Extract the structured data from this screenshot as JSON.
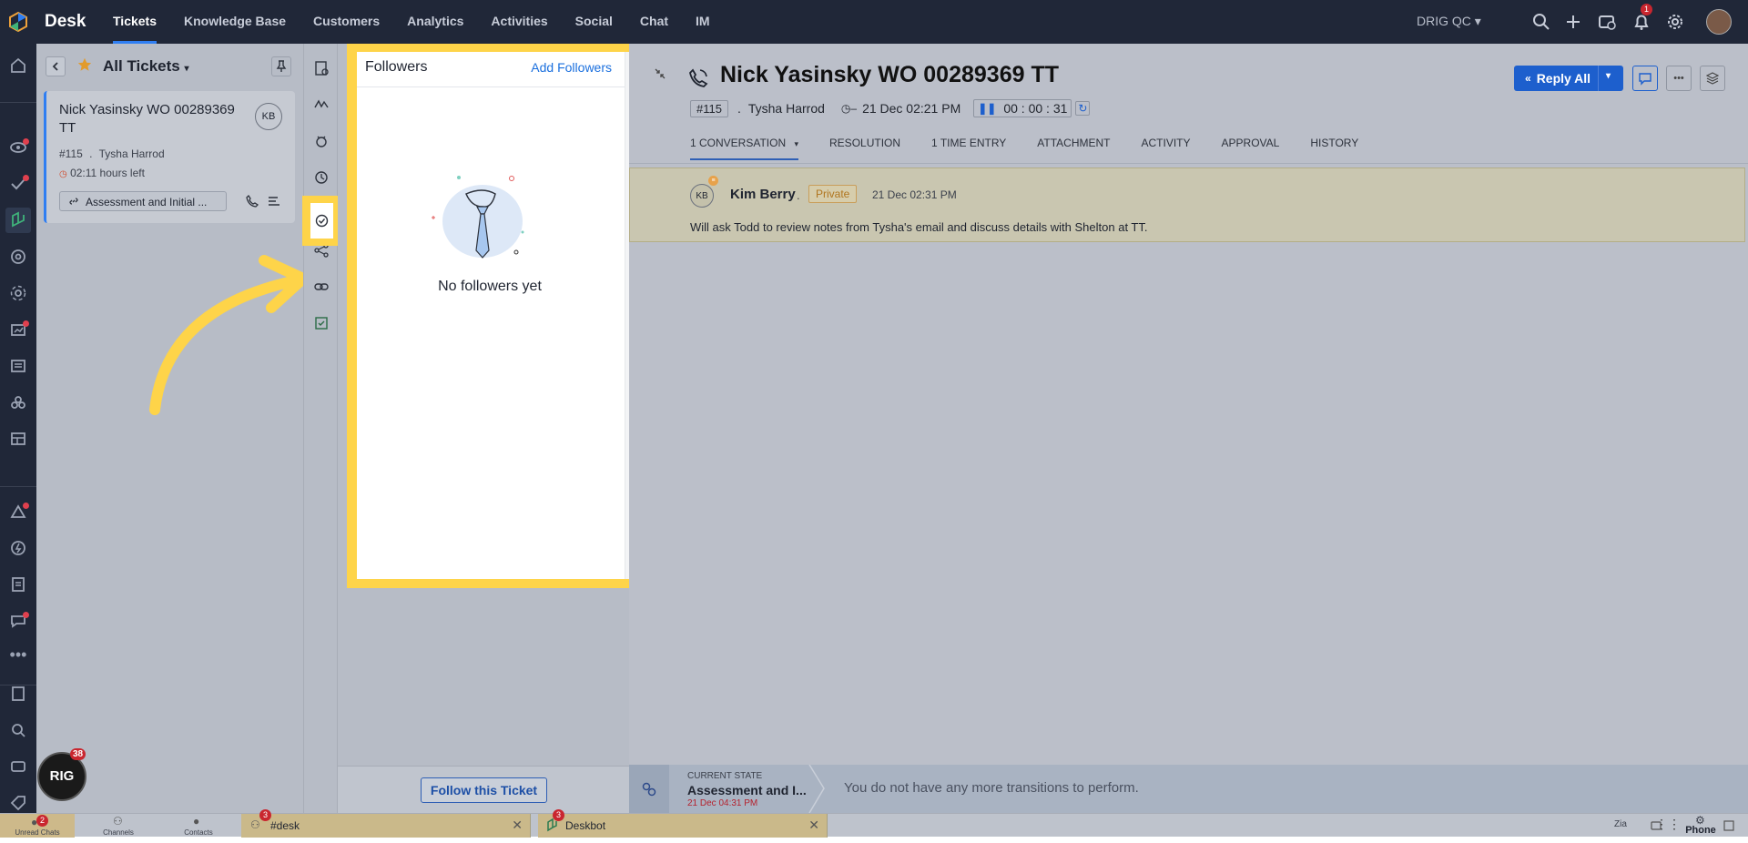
{
  "app": {
    "name": "Desk",
    "org": "DRIG QC",
    "notification_count": "1"
  },
  "nav": [
    {
      "label": "Tickets",
      "active": true
    },
    {
      "label": "Knowledge Base"
    },
    {
      "label": "Customers"
    },
    {
      "label": "Analytics"
    },
    {
      "label": "Activities"
    },
    {
      "label": "Social"
    },
    {
      "label": "Chat"
    },
    {
      "label": "IM"
    }
  ],
  "list": {
    "title": "All Tickets",
    "card": {
      "title": "Nick Yasinsky WO 00289369 TT",
      "avatar": "KB",
      "number": "#115",
      "contact": "Tysha Harrod",
      "time_left": "02:11 hours left",
      "state": "Assessment and Initial ..."
    }
  },
  "followers": {
    "title": "Followers",
    "add_label": "Add Followers",
    "empty_text": "No followers yet",
    "follow_button": "Follow this Ticket"
  },
  "ticket": {
    "title": "Nick Yasinsky WO 00289369 TT",
    "number": "#115",
    "contact": "Tysha Harrod",
    "due": "21 Dec 02:21 PM",
    "timer": "00 : 00 : 31",
    "reply_label": "Reply All",
    "tabs": [
      "1 CONVERSATION",
      "RESOLUTION",
      "1 TIME ENTRY",
      "ATTACHMENT",
      "ACTIVITY",
      "APPROVAL",
      "HISTORY"
    ],
    "conversation": {
      "avatar": "KB",
      "author": "Kim Berry",
      "visibility": "Private",
      "date": "21 Dec 02:31 PM",
      "text": "Will ask Todd to review notes from Tysha's email and discuss details with Shelton at TT."
    },
    "state": {
      "label": "CURRENT STATE",
      "value": "Assessment and I...",
      "date": "21 Dec 04:31 PM",
      "message": "You do not have any more transitions to perform."
    }
  },
  "bottom": {
    "unread_chats": "Unread Chats",
    "unread_count": "2",
    "channels": "Channels",
    "contacts": "Contacts",
    "chat1": {
      "label": "#desk",
      "count": "3"
    },
    "chat2": {
      "label": "Deskbot",
      "count": "3"
    },
    "phone": "Phone",
    "avatar_label": "RIG",
    "avatar_count": "38"
  },
  "colors": {
    "highlight": "#fed449",
    "accent": "#1d5fcd",
    "topbar": "#202738"
  }
}
